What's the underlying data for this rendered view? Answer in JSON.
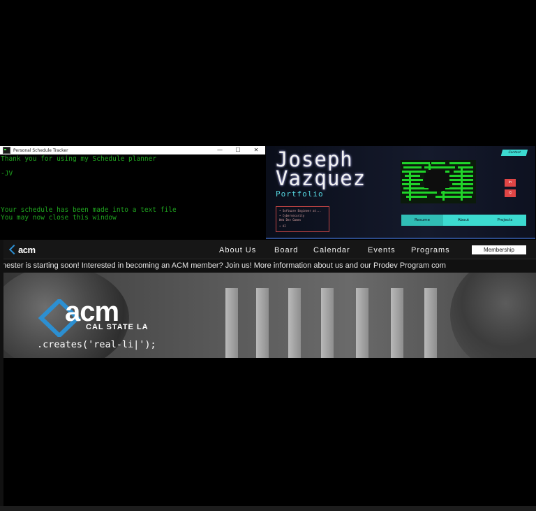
{
  "console": {
    "title": "Personal Schedule Tracker",
    "minimize": "—",
    "maximize": "☐",
    "close": "✕",
    "lines": [
      "Thank you for using my Schedule planner",
      "-JV",
      "Your schedule has been made into a text file",
      "You may now close this window"
    ]
  },
  "portfolio": {
    "first_name": "Joseph",
    "last_name": "Vazquez",
    "subtitle": "Portfolio",
    "contact_label": "Contact",
    "social": [
      {
        "label": "in",
        "icon": "linkedin-icon"
      },
      {
        "label": "⌬",
        "icon": "github-icon"
      }
    ],
    "info_items": [
      "• Software Engineer at...",
      "• Cybersecurity",
      "  Web Dev Games",
      "• AI"
    ],
    "nav": [
      "Resume",
      "About",
      "Projects"
    ],
    "colors": {
      "accent": "#3cdad0",
      "social": "#e04545",
      "info_border": "#c24444"
    }
  },
  "acm": {
    "logo_text": "acm",
    "nav_links": [
      "About Us",
      "Board",
      "Calendar",
      "Events",
      "Programs"
    ],
    "membership_label": "Membership",
    "ticker": "nester is starting soon! Interested in becoming an ACM member? Join us! More information about us and our Prodev Program com",
    "hero_logo_text": "acm",
    "hero_logo_sub": "CAL STATE LA",
    "hero_tagline": ".creates('real-li|');",
    "colors": {
      "brand_blue": "#2c8fd1"
    }
  }
}
